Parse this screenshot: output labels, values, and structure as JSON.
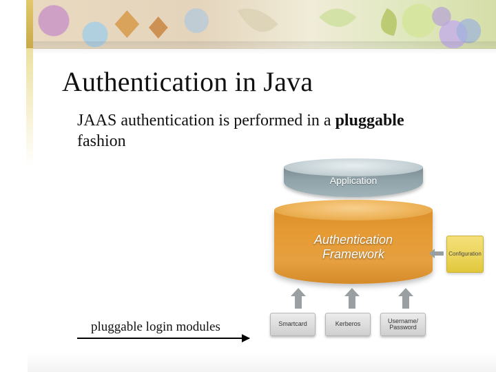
{
  "title": "Authentication in Java",
  "body": {
    "prefix": "JAAS authentication is performed in a ",
    "bold": "pluggable",
    "suffix": " fashion"
  },
  "caption": "pluggable login modules",
  "diagram": {
    "application": "Application",
    "framework_line1": "Authentication",
    "framework_line2": "Framework",
    "configuration": "Configuration",
    "modules": [
      "Smartcard",
      "Kerberos",
      "Username/ Password"
    ]
  }
}
